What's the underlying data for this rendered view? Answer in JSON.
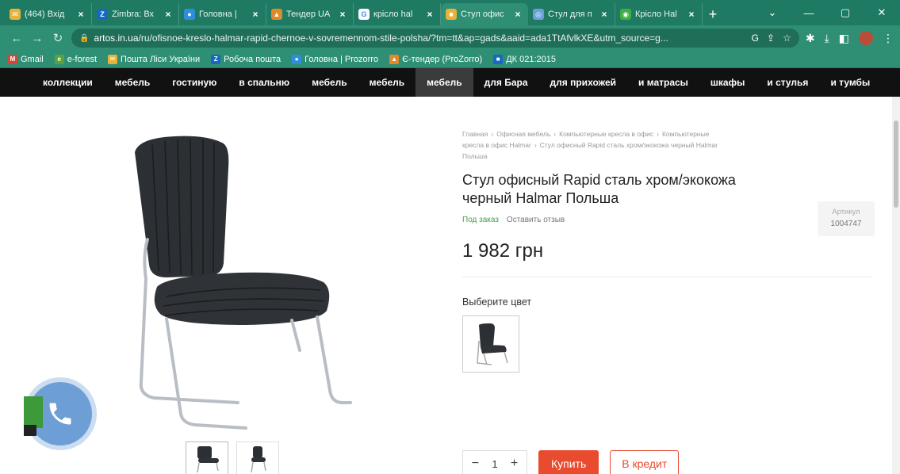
{
  "tabs": [
    {
      "title": "(464) Вхід",
      "icon": "mail-icon",
      "color": "#e8b23a",
      "glyph": "✉"
    },
    {
      "title": "Zimbra: Вх",
      "icon": "zimbra-icon",
      "color": "#1668c4",
      "glyph": "Z"
    },
    {
      "title": "Головна |",
      "icon": "prozorro-icon",
      "color": "#2f8edc",
      "glyph": "●"
    },
    {
      "title": "Тендер UA",
      "icon": "tender-icon",
      "color": "#e08a2a",
      "glyph": "▲"
    },
    {
      "title": "крісло hal",
      "icon": "google-icon",
      "color": "#ffffff",
      "glyph": "G"
    },
    {
      "title": "Стул офис",
      "icon": "artos-icon",
      "color": "#e8b23a",
      "glyph": "■"
    },
    {
      "title": "Стул для п",
      "icon": "site-icon",
      "color": "#6aa0d8",
      "glyph": "◎"
    },
    {
      "title": "Крісло Hal",
      "icon": "site2-icon",
      "color": "#3cb043",
      "glyph": "◉"
    }
  ],
  "active_tab": 5,
  "url": {
    "domain": "artos.in.ua",
    "path": "/ru/ofisnoe-kreslo-halmar-rapid-chernoe-v-sovremennom-stile-polsha/?tm=tt&ap=gads&aaid=ada1TtAfvlkXE&utm_source=g..."
  },
  "bookmarks": [
    {
      "label": "Gmail",
      "icon": "gmail-icon",
      "color": "#d44638",
      "glyph": "M"
    },
    {
      "label": "e-forest",
      "icon": "eforest-icon",
      "color": "#5aa33c",
      "glyph": "e"
    },
    {
      "label": "Пошта Ліси України",
      "icon": "mail-icon",
      "color": "#e8b23a",
      "glyph": "✉"
    },
    {
      "label": "Робоча пошта",
      "icon": "zimbra-icon",
      "color": "#1668c4",
      "glyph": "Z"
    },
    {
      "label": "Головна | Prozorro",
      "icon": "prozorro-icon",
      "color": "#2f8edc",
      "glyph": "●"
    },
    {
      "label": "Є-тендер (ProZorro)",
      "icon": "tender-icon",
      "color": "#e08a2a",
      "glyph": "▲"
    },
    {
      "label": "ДК 021:2015",
      "icon": "dk-icon",
      "color": "#1668c4",
      "glyph": "■"
    }
  ],
  "site_nav": [
    {
      "label": "коллекции"
    },
    {
      "label": "мебель"
    },
    {
      "label": "гостиную"
    },
    {
      "label": "в спальню"
    },
    {
      "label": "мебель"
    },
    {
      "label": "мебель"
    },
    {
      "label": "мебель",
      "active": true
    },
    {
      "label": "для Бара"
    },
    {
      "label": "для прихожей"
    },
    {
      "label": "и матрасы"
    },
    {
      "label": "шкафы"
    },
    {
      "label": "и стулья"
    },
    {
      "label": "и тумбы"
    }
  ],
  "breadcrumbs": [
    "Главная",
    "Офисная мебель",
    "Компьютерные кресла в офис",
    "Компьютерные кресла в офис Halmar",
    "Стул офисный Rapid сталь хром/экокожа черный Halmar Польша"
  ],
  "product": {
    "title": "Стул офисный Rapid сталь хром/экокожа черный Halmar Польша",
    "sku_label": "Артикул",
    "sku": "1004747",
    "status": "Под заказ",
    "review_link": "Оставить отзыв",
    "price": "1 982 грн",
    "color_label": "Выберите цвет",
    "quantity": "1",
    "buy_label": "Купить",
    "credit_label": "В кредит"
  },
  "colors": {
    "accent": "#e94b2f",
    "status_green": "#41a047",
    "browser_green": "#2e8f74"
  }
}
